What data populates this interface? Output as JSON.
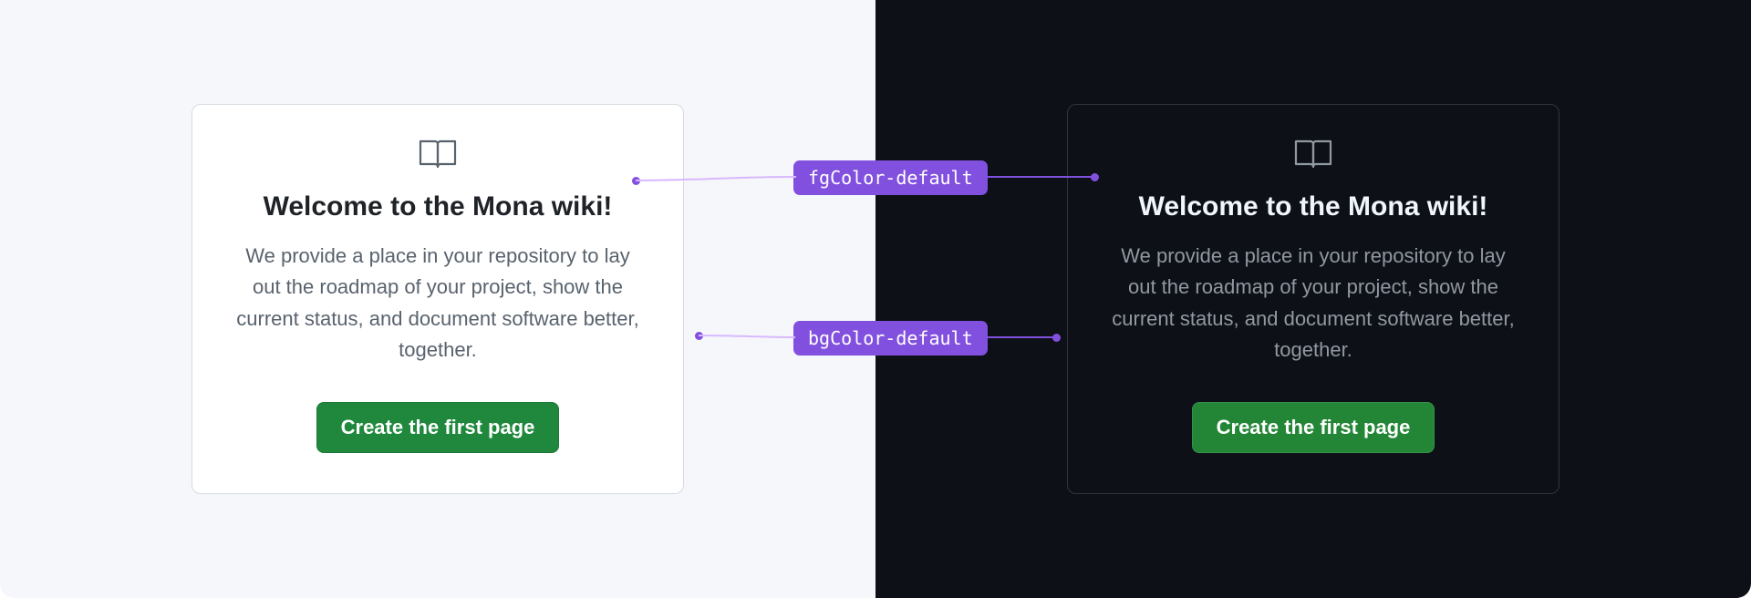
{
  "light": {
    "title": "Welcome to the Mona wiki!",
    "description": "We provide a place in your repository to lay out the roadmap of your project, show the current status, and document software better, together.",
    "button": "Create the first page"
  },
  "dark": {
    "title": "Welcome to the Mona wiki!",
    "description": "We provide a place in your repository to lay out the roadmap of your project, show the current status, and document software better, together.",
    "button": "Create the first page"
  },
  "annotations": {
    "fg": "fgColor-default",
    "bg": "bgColor-default"
  }
}
